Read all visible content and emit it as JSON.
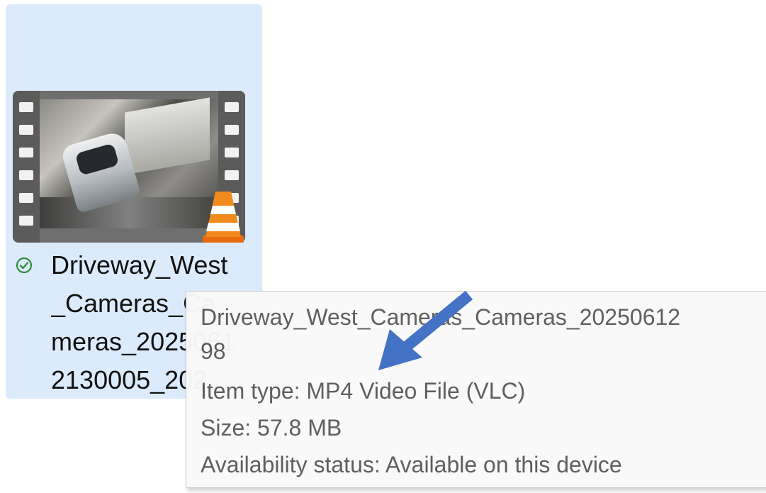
{
  "file": {
    "name_lines": [
      "Driveway_West",
      "_Cameras_Ca",
      "meras_2025061",
      "2130005_202"
    ],
    "status_icon": "check-circle-icon",
    "thumbnail_icon": "video-thumbnail-icon",
    "app_badge_icon": "vlc-cone-icon"
  },
  "tooltip": {
    "lines": [
      "Driveway_West_Cameras_Cameras_20250612",
      "98",
      "Item type: MP4 Video File (VLC)",
      "Size: 57.8 MB",
      "Availability status: Available on this device"
    ]
  },
  "annotation": {
    "arrow_icon": "arrow-icon",
    "arrow_color": "#4472c4"
  },
  "colors": {
    "selection_bg": "#dcebfb",
    "status_green": "#2f8f3f",
    "tooltip_text": "#5a5a5a"
  }
}
